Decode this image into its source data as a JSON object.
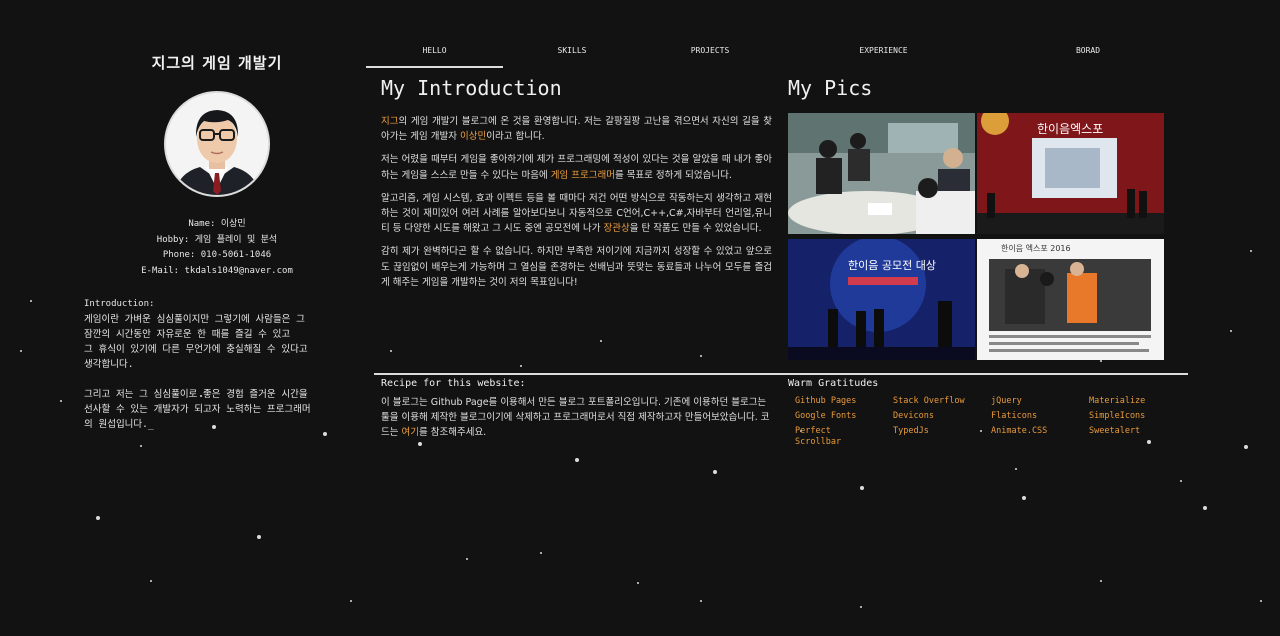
{
  "colors": {
    "background": "#121212",
    "accent": "#f0a040",
    "link": "#e89a3c",
    "text": "#e6e6e6"
  },
  "sidebar": {
    "title": "지그의 게임 개발기",
    "name": "Name: 이상민",
    "hobby": "Hobby: 게임 플레이 및 분석",
    "phone": "Phone: 010-5061-1046",
    "email": "E-Mail: tkdals1049@naver.com",
    "intro_head": "Introduction:",
    "intro_p1": "게임이란 가벼운 심심풀이지만 그렇기에 사람들은 그\n잠깐의 시간동안 자유로운 한 때를 즐길 수 있고\n그 휴식이 있기에 다른 무언가에 충실해질 수 있다고\n생각합니다.",
    "intro_p2": "그리고 저는 그 심심풀이로 좋은 경험 즐거운 시간을\n선사할 수 있는 개발자가 되고자 노력하는 프로그래머\n의 원섭입니다._"
  },
  "nav": {
    "tabs": [
      "HELLO",
      "SKILLS",
      "PROJECTS",
      "EXPERIENCE",
      "BORAD"
    ]
  },
  "introduction": {
    "title": "My Introduction",
    "p1_hl1": "지그",
    "p1_a": "의 게임 개발기 블로그에 온 것을 환영합니다. 저는 갈팡질팡 고난을 겪으면서 자신의 길을 찾아가는 게임 개발자 ",
    "p1_hl2": "이상민",
    "p1_b": "이라고 합니다.",
    "p2_a": "저는 어렸을 때부터 게임을 좋아하기에 제가 프로그래밍에 적성이 있다는 것을 알았을 때 내가 좋아하는 게임을 스스로 만들 수 있다는 마음에 ",
    "p2_hl": "게임 프로그래머",
    "p2_b": "를 목표로 정하게 되었습니다.",
    "p3_a": "알고리즘, 게임 시스템, 효과 이펙트 등을 볼 때마다 저건 어떤 방식으로 작동하는지 생각하고 재현하는 것이 재미있어 여러 사례를 알아보다보니 자동적으로 C언어,C++,C#,자바부터 언리얼,유니티 등 다양한 시도를 해왔고 그 시도 중엔 공모전에 나가 ",
    "p3_hl": "장관상",
    "p3_b": "을 탄 작품도 만들 수 있었습니다.",
    "p4": "감히 제가 완벽하다곤 할 수 없습니다. 하지만 부족한 저이기에 지금까지 성장할 수 있었고 앞으로도 끊임없이 배우는게 가능하며 그 열심을 존경하는 선배님과 뜻맞는 동료들과 나누어 모두를 즐겁게 해주는 게임을 개발하는 것이 저의 목표입니다!"
  },
  "pics": {
    "title": "My Pics",
    "photos": [
      "meeting-photo",
      "exhibition-stage-photo",
      "award-ceremony-photo",
      "news-article-photo"
    ]
  },
  "recipe": {
    "title": "Recipe for this website:",
    "body_a": "이 블로그는 Github Page를 이용해서 만든 블로그 포트폴리오입니다. 기존에 이용하던 블로그는 툴을 이용해 제작한 블로그이기에 삭제하고 프로그래머로서 직접 제작하고자 만들어보았습니다. 코드는 ",
    "body_hl": "여기",
    "body_b": "를 참조해주세요."
  },
  "thanks": {
    "title": "Warm Gratitudes",
    "links": [
      "Github Pages",
      "Stack Overflow",
      "jQuery",
      "Materialize",
      "Google Fonts",
      "Devicons",
      "Flaticons",
      "SimpleIcons",
      "Perfect Scrollbar",
      "TypedJs",
      "Animate.CSS",
      "Sweetalert"
    ]
  }
}
